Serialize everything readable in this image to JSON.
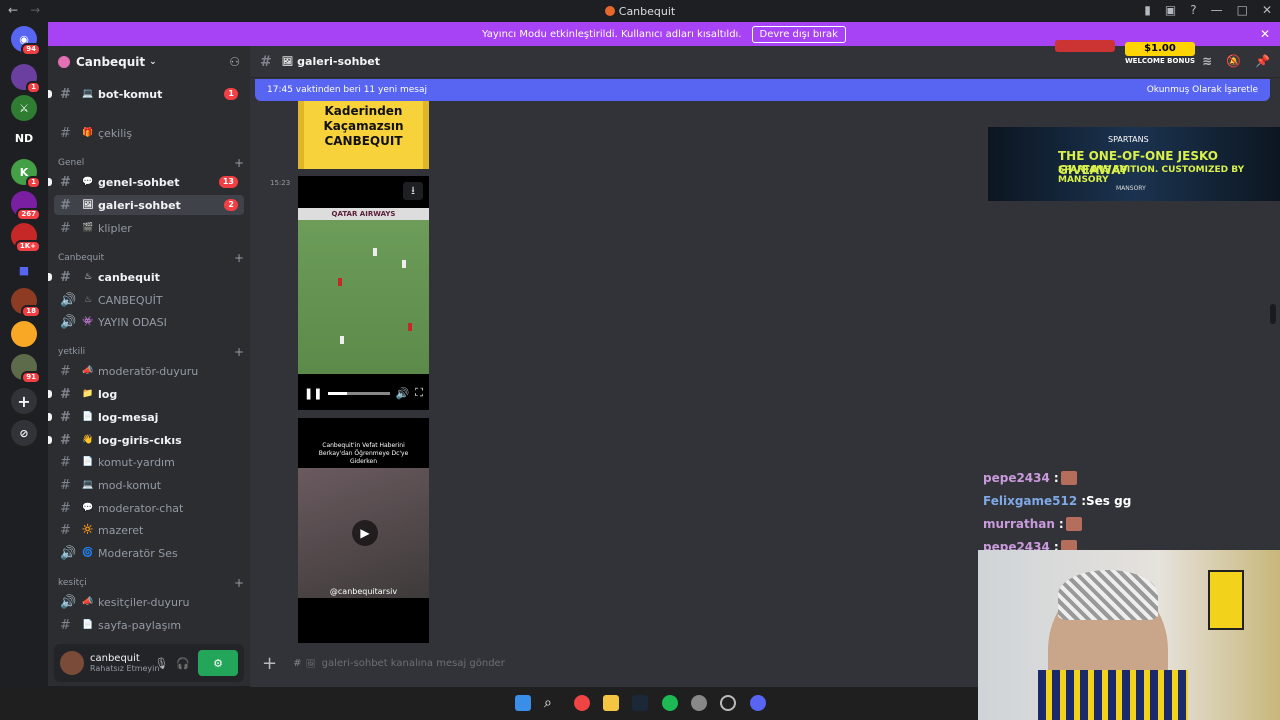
{
  "window": {
    "title": "Canbequit",
    "nav_back": "←",
    "nav_forward": "→"
  },
  "banner": {
    "text": "Yayıncı Modu etkinleştirildi. Kullanıcı adları kısaltıldı.",
    "button": "Devre dışı bırak"
  },
  "guilds": [
    {
      "label": "",
      "badge": "94",
      "color": "#5865f2"
    },
    {
      "label": "",
      "badge": "1",
      "color": "#6b3fa0"
    },
    {
      "label": "",
      "badge": "",
      "color": "#2e7d32"
    },
    {
      "label": "ND",
      "badge": "",
      "color": "#1e1f22"
    },
    {
      "label": "",
      "badge": "1",
      "color": "#43a047"
    },
    {
      "label": "",
      "badge": "267",
      "color": "#7b1fa2"
    },
    {
      "label": "",
      "badge": "1K+",
      "color": "#c62828"
    },
    {
      "label": "",
      "badge": "",
      "color": "#1e1f22"
    },
    {
      "label": "",
      "badge": "18",
      "color": "#8d3b22"
    },
    {
      "label": "",
      "badge": "",
      "color": "#f9a825"
    },
    {
      "label": "",
      "badge": "91",
      "color": "#5d6b4a"
    }
  ],
  "server": {
    "name": "Canbequit"
  },
  "categories": {
    "genel": "Genel",
    "canbequit": "Canbequit",
    "yetkili": "yetkili",
    "kesitci": "kesitçi"
  },
  "channels": [
    {
      "name": "bot-komut",
      "emoji": "💻",
      "badge": "1"
    },
    {
      "name": "çekiliş",
      "emoji": "🎁",
      "badge": ""
    },
    {
      "name": "genel-sohbet",
      "emoji": "💬",
      "badge": "13"
    },
    {
      "name": "galeri-sohbet",
      "emoji": "🖼",
      "badge": "2"
    },
    {
      "name": "klipler",
      "emoji": "🎬",
      "badge": ""
    },
    {
      "name": "canbequit",
      "emoji": "♨",
      "badge": ""
    },
    {
      "name": "CANBEQUİT",
      "emoji": "♨",
      "badge": ""
    },
    {
      "name": "YAYIN ODASI",
      "emoji": "👾",
      "badge": ""
    },
    {
      "name": "moderatör-duyuru",
      "emoji": "📣",
      "badge": ""
    },
    {
      "name": "log",
      "emoji": "📁",
      "badge": ""
    },
    {
      "name": "log-mesaj",
      "emoji": "📄",
      "badge": ""
    },
    {
      "name": "log-giris-cıkıs",
      "emoji": "👋",
      "badge": ""
    },
    {
      "name": "komut-yardım",
      "emoji": "📄",
      "badge": ""
    },
    {
      "name": "mod-komut",
      "emoji": "💻",
      "badge": ""
    },
    {
      "name": "moderator-chat",
      "emoji": "💬",
      "badge": ""
    },
    {
      "name": "mazeret",
      "emoji": "🔆",
      "badge": ""
    },
    {
      "name": "Moderatör Ses",
      "emoji": "🌀",
      "badge": ""
    },
    {
      "name": "kesitçiler-duyuru",
      "emoji": "📣",
      "badge": ""
    },
    {
      "name": "sayfa-paylaşım",
      "emoji": "📄",
      "badge": ""
    }
  ],
  "user": {
    "name": "canbequit",
    "status": "Rahatsız Etmeyin"
  },
  "header": {
    "channel": "galeri-sohbet"
  },
  "newbar": {
    "text": "17:45 vaktinden beri 11 yeni mesaj",
    "action": "Okunmuş Olarak İşaretle"
  },
  "messages": {
    "timestamp": "15:23",
    "sign_lines": [
      "Kaderinden",
      "Kaçamazsın",
      "CANBEQUIT"
    ],
    "video_banner": "QATAR AIRWAYS",
    "clip_caption": "Canbequit'in Vefat Haberini Berkay'dan Öğrenmeye Dc'ye Giderken",
    "clip_handle": "@canbequitarsiv"
  },
  "composer": {
    "placeholder": "galeri-sohbet kanalına mesaj gönder"
  },
  "ad_spartans": {
    "brand": "SPARTANS",
    "line1": "THE ONE-OF-ONE JESKO GIVEAWAY",
    "line2": "SPARTANS EDITION. CUSTOMIZED BY MANSORY",
    "line3": "MANSORY"
  },
  "ad_case": {
    "amount": "$1.00",
    "label": "WELCOME BONUS"
  },
  "stream_chat": [
    {
      "user": "pepe2434",
      "msg": "",
      "color": "#c99bdc",
      "emote": true
    },
    {
      "user": "Felixgame512",
      "msg": "Ses gg",
      "color": "#7fa9e6",
      "emote": false
    },
    {
      "user": "murrathan",
      "msg": "",
      "color": "#c99bdc",
      "emote": true
    },
    {
      "user": "pepe2434",
      "msg": "",
      "color": "#c99bdc",
      "emote": true
    }
  ],
  "colors": {
    "accent": "#5865f2",
    "banner": "#a742f5",
    "unread_badge": "#f23f43",
    "online": "#23a55a"
  }
}
